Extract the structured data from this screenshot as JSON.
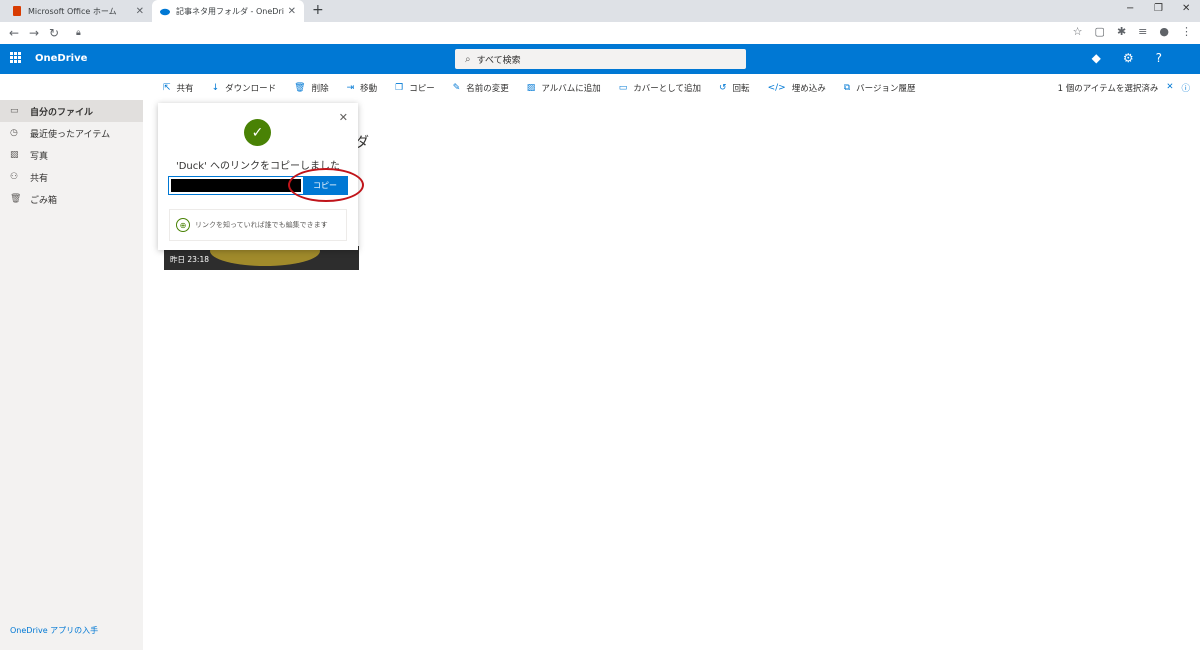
{
  "browser": {
    "tabs": [
      {
        "title": "Microsoft Office ホーム"
      },
      {
        "title": "記事ネタ用フォルダ - OneDrive"
      }
    ],
    "new_tab": "+",
    "window_controls": [
      "−",
      "❐",
      "✕"
    ]
  },
  "header": {
    "app_name": "OneDrive",
    "search_placeholder": "すべて検索"
  },
  "commands": [
    {
      "icon": "share-icon",
      "label": "共有"
    },
    {
      "icon": "download-icon",
      "label": "ダウンロード"
    },
    {
      "icon": "delete-icon",
      "label": "削除"
    },
    {
      "icon": "move-icon",
      "label": "移動"
    },
    {
      "icon": "copy-icon",
      "label": "コピー"
    },
    {
      "icon": "rename-icon",
      "label": "名前の変更"
    },
    {
      "icon": "add-album-icon",
      "label": "アルバムに追加"
    },
    {
      "icon": "add-cover-icon",
      "label": "カバーとして追加"
    },
    {
      "icon": "rotate-icon",
      "label": "回転"
    },
    {
      "icon": "embed-icon",
      "label": "埋め込み"
    },
    {
      "icon": "version-history-icon",
      "label": "バージョン履歴"
    }
  ],
  "selection": {
    "text": "1 個のアイテムを選択済み"
  },
  "sidebar": {
    "items": [
      {
        "icon": "folder-icon",
        "label": "自分のファイル",
        "selected": true
      },
      {
        "icon": "recent-icon",
        "label": "最近使ったアイテム"
      },
      {
        "icon": "photo-icon",
        "label": "写真"
      },
      {
        "icon": "shared-icon",
        "label": "共有"
      },
      {
        "icon": "recycle-bin-icon",
        "label": "ごみ箱"
      }
    ],
    "get_app": "OneDrive アプリの入手"
  },
  "main": {
    "folder_title_fragment": "ダ",
    "tile_date": "昨日 23:18"
  },
  "dialog": {
    "title": "'Duck' へのリンクをコピーしました",
    "copy_button": "コピー",
    "permission": "リンクを知っていれば誰でも編集できます"
  },
  "colors": {
    "brand": "#0078d4",
    "success": "#498205",
    "highlight_ring": "#c0141a"
  }
}
